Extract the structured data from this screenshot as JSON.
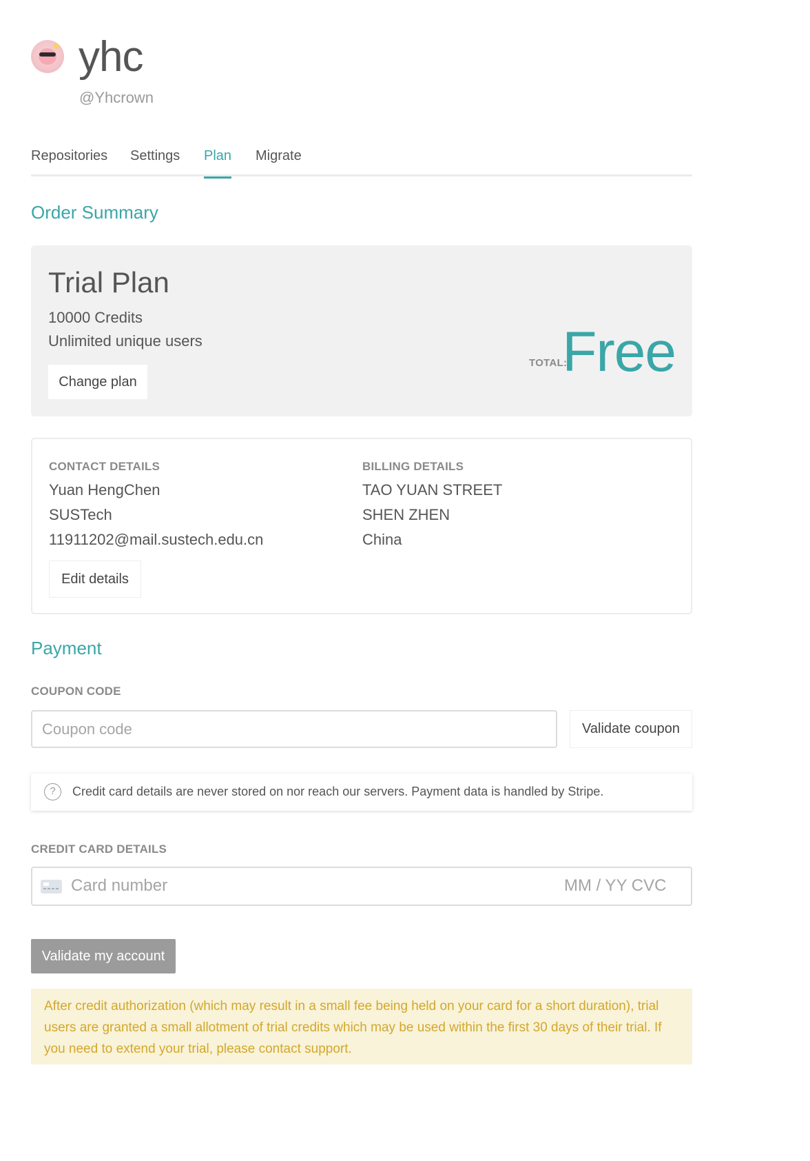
{
  "profile": {
    "username": "yhc",
    "handle": "@Yhcrown"
  },
  "tabs": [
    {
      "label": "Repositories",
      "active": false
    },
    {
      "label": "Settings",
      "active": false
    },
    {
      "label": "Plan",
      "active": true
    },
    {
      "label": "Migrate",
      "active": false
    }
  ],
  "colors": {
    "accent": "#3aa6a8",
    "warning_text": "#d4a72c",
    "warning_bg": "#f8f3d9"
  },
  "order_summary": {
    "title": "Order Summary",
    "plan_name": "Trial Plan",
    "credits": "10000 Credits",
    "users": "Unlimited unique users",
    "change_plan_label": "Change plan",
    "total_label": "TOTAL:",
    "total_value": "Free"
  },
  "details": {
    "contact_heading": "CONTACT DETAILS",
    "contact_lines": [
      "Yuan HengChen",
      "SUSTech",
      "11911202@mail.sustech.edu.cn"
    ],
    "billing_heading": "BILLING DETAILS",
    "billing_lines": [
      "TAO YUAN STREET",
      "SHEN ZHEN",
      "China"
    ],
    "edit_label": "Edit details"
  },
  "payment": {
    "title": "Payment",
    "coupon_label": "COUPON CODE",
    "coupon_placeholder": "Coupon code",
    "coupon_value": "",
    "validate_coupon_label": "Validate coupon",
    "notice_icon": "question-circle-icon",
    "notice_text": "Credit card details are never stored on nor reach our servers. Payment data is handled by Stripe.",
    "card_label": "CREDIT CARD DETAILS",
    "card_icon": "credit-card-icon",
    "card_placeholder": "Card number",
    "card_expiry_placeholder": "MM / YY  CVC",
    "validate_account_label": "Validate my account",
    "warning_text": "After credit authorization (which may result in a small fee being held on your card for a short duration), trial users are granted a small allotment of trial credits which may be used within the first 30 days of their trial. If you need to extend your trial, please contact support."
  }
}
